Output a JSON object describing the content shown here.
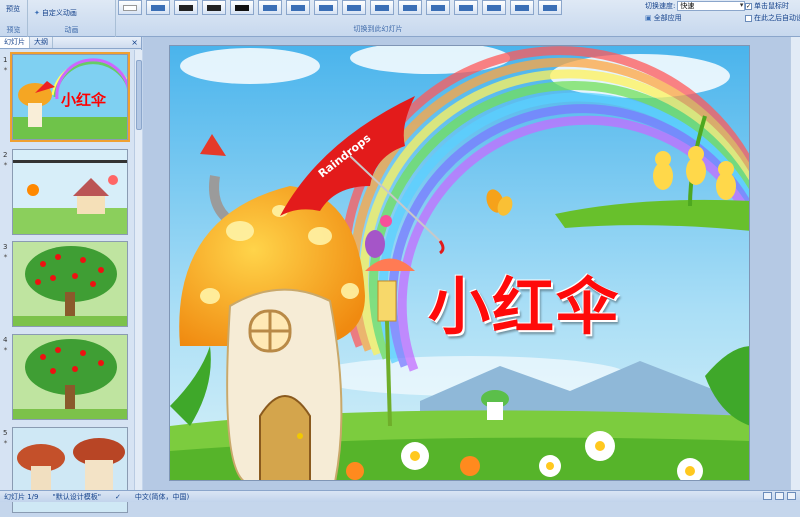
{
  "ribbon": {
    "preview_label": "预览",
    "preview_group": "预览",
    "animation_custom": "自定义动画",
    "animation_group": "动画",
    "transition_group": "切换到此幻灯片",
    "speed_label": "切换速度:",
    "speed_value": "快速",
    "apply_all": "全部应用",
    "on_click": "单击鼠标时",
    "after_auto": "在此之后自动设"
  },
  "pane": {
    "tab_slides": "幻灯片",
    "tab_outline": "大纲",
    "close": "×",
    "slides": [
      {
        "num": "1",
        "title": "小红伞"
      },
      {
        "num": "2"
      },
      {
        "num": "3"
      },
      {
        "num": "4"
      },
      {
        "num": "5"
      }
    ]
  },
  "slide": {
    "title": "小红伞",
    "umbrella_text": "Raindrops"
  },
  "status": {
    "slide_pos": "幻灯片 1/9",
    "theme": "\"默认设计模板\"",
    "language": "中文(简体，中国)"
  },
  "colors": {
    "title_red": "#ff0a0a",
    "ribbon_bg": "#dfe9f5",
    "sky": "#6ec8f0"
  }
}
